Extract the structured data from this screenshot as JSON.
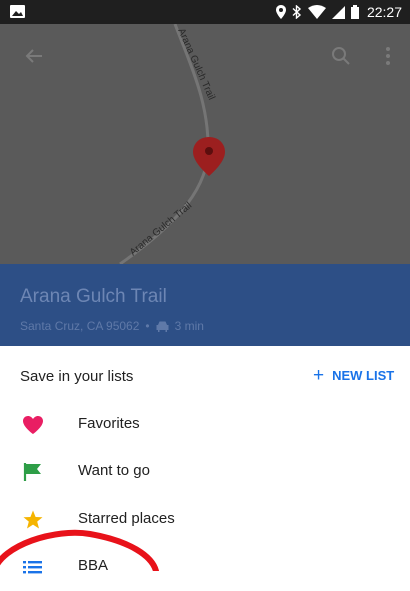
{
  "status_bar": {
    "time": "22:27"
  },
  "map": {
    "road_label_top": "Arana Gulch Trail",
    "road_label_bottom": "Arana Gulch Trail"
  },
  "place": {
    "title": "Arana Gulch Trail",
    "address": "Santa Cruz, CA 95062",
    "separator": "•",
    "drive_time": "3 min"
  },
  "sheet": {
    "title": "Save in your lists",
    "new_list_label": "NEW LIST",
    "new_list_plus": "+",
    "lists": [
      {
        "label": "Favorites",
        "icon": "heart-icon",
        "color": "#e91e63"
      },
      {
        "label": "Want to go",
        "icon": "flag-icon",
        "color": "#2e9e47"
      },
      {
        "label": "Starred places",
        "icon": "star-icon",
        "color": "#f5b400"
      },
      {
        "label": "BBA",
        "icon": "list-icon",
        "color": "#1a73e8"
      }
    ]
  },
  "colors": {
    "accent": "#1a73e8",
    "header_bg": "#2d4f86",
    "annotation": "#e8121a"
  }
}
